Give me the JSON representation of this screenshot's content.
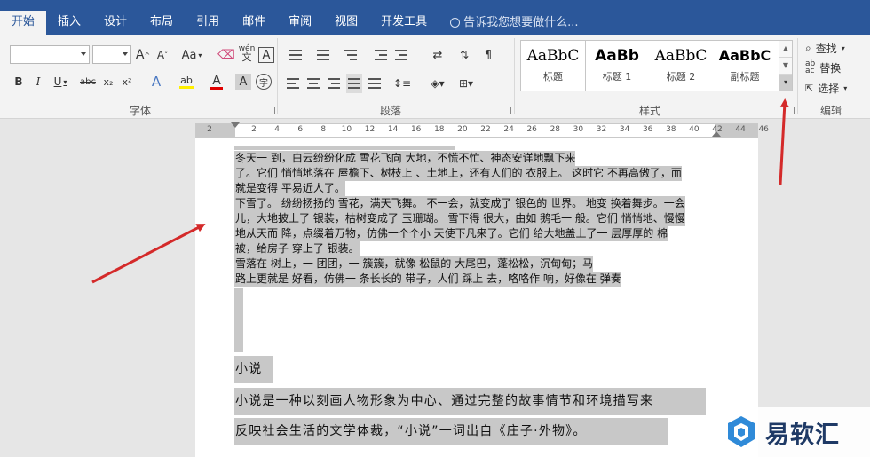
{
  "tabs": [
    "开始",
    "插入",
    "设计",
    "布局",
    "引用",
    "邮件",
    "审阅",
    "视图",
    "开发工具"
  ],
  "tell_me": "告诉我您想要做什么...",
  "font_group": {
    "label": "字体",
    "font_name": "",
    "font_size": "",
    "grow": "A",
    "shrink": "A",
    "case": "Aa",
    "phonetic": "wén",
    "border_char": "A",
    "bold": "B",
    "italic": "I",
    "underline": "U",
    "strike": "abc",
    "sub": "x₂",
    "sup": "x²",
    "effects": "A",
    "highlight": "ab",
    "color": "A",
    "shade": "A",
    "enclose": "字"
  },
  "paragraph_group": {
    "label": "段落"
  },
  "styles_group": {
    "label": "样式",
    "items": [
      {
        "sample": "AaBbC",
        "name": "标题"
      },
      {
        "sample": "AaBb",
        "name": "标题 1"
      },
      {
        "sample": "AaBbC",
        "name": "标题 2"
      },
      {
        "sample": "AaBbC",
        "name": "副标题"
      }
    ]
  },
  "editing_group": {
    "label": "编辑",
    "find": "查找",
    "replace": "替换",
    "select": "选择"
  },
  "ruler": {
    "labels": [
      "2",
      "2",
      "4",
      "6",
      "8",
      "10",
      "12",
      "14",
      "16",
      "18",
      "20",
      "22",
      "24",
      "26",
      "28",
      "30",
      "32",
      "34",
      "36",
      "38",
      "40",
      "42",
      "44",
      "46"
    ]
  },
  "document": {
    "lines": [
      "冬天一 到，白云纷纷化成 雪花飞向 大地，不慌不忙、神态安详地飘下来",
      "了。它们 悄悄地落在 屋檐下、树枝上 、土地上，还有人们的 衣服上。 这时它 不再高傲了，而",
      "就是变得 平易近人了。",
      "下雪了。 纷纷扬扬的 雪花，满天飞舞。 不一会，就变成了 银色的 世界。 地变 换着舞步。一会",
      "儿，大地披上了 银装，枯树变成了 玉珊瑚。 雪下得 很大，由如 鹅毛一 般。它们 悄悄地、慢慢",
      "地从天而 降，点缀着万物，仿佛一个个小 天使下凡来了。它们 给大地盖上了一 层厚厚的 棉",
      "被，给房子 穿上了 银装。",
      "雪落在 树上，一 团团，一 簇簇，就像 松鼠的 大尾巴，蓬松松，沉甸甸；马",
      "路上更就是 好看，仿佛一 条长长的 带子，人们 踩上 去，咯咯作 响，好像在 弹奏"
    ],
    "heading": "小说",
    "para_lines": [
      "小说是一种以刻画人物形象为中心、通过完整的故事情节和环境描写来",
      "反映社会生活的文学体裁，“小说”一词出自《庄子·外物》。"
    ]
  },
  "watermark": {
    "text": "易软汇"
  },
  "colors": {
    "ribbon_blue": "#2b579a",
    "selection_gray": "#c8c8c8",
    "arrow_red": "#d42a2a"
  }
}
